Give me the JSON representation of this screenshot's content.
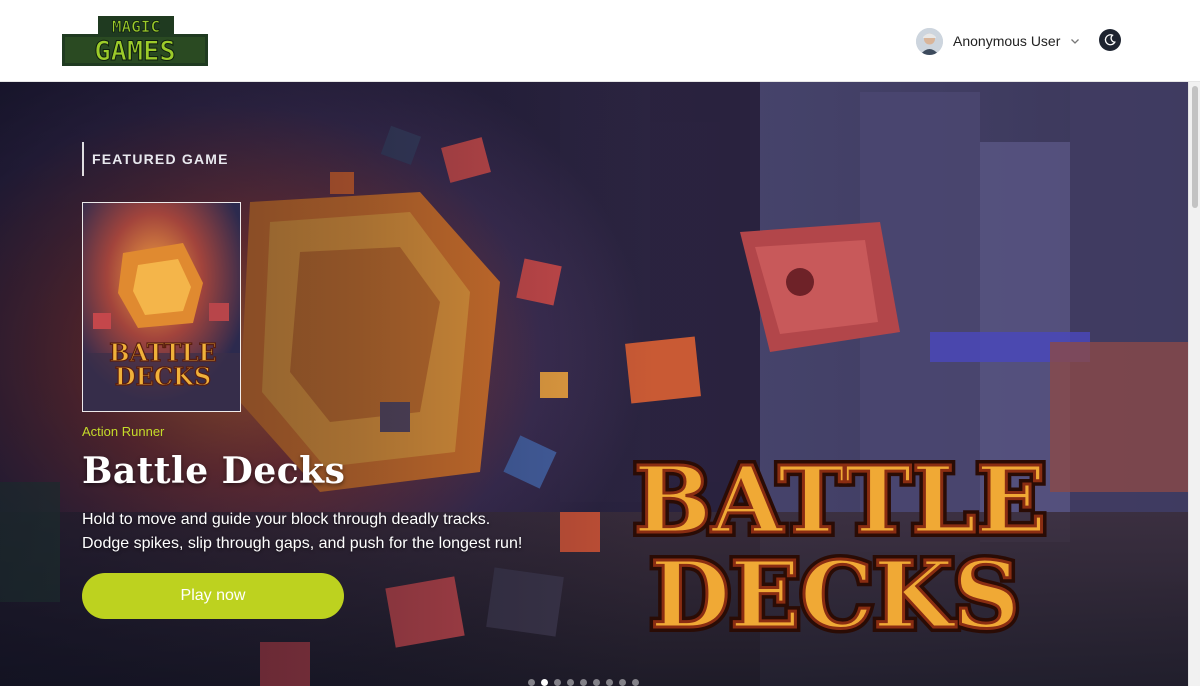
{
  "header": {
    "logo_line1": "MAGIC",
    "logo_line2": "GAMES",
    "user_name": "Anonymous User"
  },
  "hero": {
    "featured_label": "FEATURED GAME",
    "genre": "Action Runner",
    "title": "Battle Decks",
    "description_line1": "Hold to move and guide your block through deadly tracks.",
    "description_line2": "Dodge spikes, slip through gaps, and push for the longest run!",
    "play_label": "Play now",
    "cover_line1": "BATTLE",
    "cover_line2": "DECKS",
    "art_line1": "BATTLE",
    "art_line2": "DECKS"
  },
  "carousel": {
    "slide_count": 9,
    "active_index": 1
  },
  "colors": {
    "accent": "#bdd21f",
    "genre": "#c5dc2a",
    "logo_green": "#9ccb2a",
    "logo_dark": "#1f3a20",
    "toggle_bg": "#1e2430"
  },
  "icons": {
    "theme_toggle": "moon-icon",
    "user_menu": "chevron-down-icon"
  }
}
